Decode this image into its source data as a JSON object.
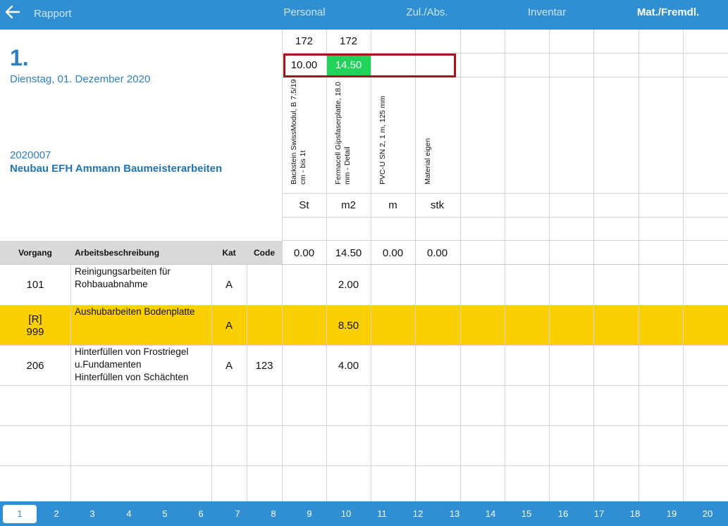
{
  "nav": {
    "back_label": "Rapport",
    "tabs": [
      "Personal",
      "Zul./Abs.",
      "Inventar",
      "Mat./Fremdl."
    ],
    "active_tab": "Mat./Fremdl."
  },
  "report": {
    "day_number": "1.",
    "date": "Dienstag, 01. Dezember 2020",
    "project_number": "2020007",
    "project_name": "Neubau EFH Ammann Baumeisterarbeiten"
  },
  "materials": {
    "ids": [
      "172",
      "172",
      "",
      ""
    ],
    "input_values": [
      "10.00",
      "14.50",
      "",
      ""
    ],
    "names": [
      "Backstein SwissModul, B 7.5/19 cm - bis 1t",
      "Fermacell Gipsfaserplatte, 18.0 mm - Detail",
      "PVC-U SN 2, 1 m, 125 mm",
      "Material eigen"
    ],
    "units": [
      "St",
      "m2",
      "m",
      "stk"
    ],
    "totals": [
      "0.00",
      "14.50",
      "0.00",
      "0.00"
    ]
  },
  "table": {
    "headers": {
      "vorgang": "Vorgang",
      "beschreibung": "Arbeitsbeschreibung",
      "kat": "Kat",
      "code": "Code"
    },
    "rows": [
      {
        "vorgang_tag": "",
        "vorgang": "101",
        "desc": [
          "Reinigungsarbeiten für",
          "Rohbauabnahme"
        ],
        "kat": "A",
        "code": "",
        "m2_value": "2.00"
      },
      {
        "vorgang_tag": "[R]",
        "vorgang": "999",
        "desc": [
          "Aushubarbeiten Bodenplatte"
        ],
        "kat": "A",
        "code": "",
        "m2_value": "8.50"
      },
      {
        "vorgang_tag": "",
        "vorgang": "206",
        "desc": [
          "Hinterfüllen von Frostriegel",
          "u.Fundamenten",
          "Hinterfüllen von Schächten"
        ],
        "kat": "A",
        "code": "123",
        "m2_value": "4.00"
      }
    ]
  },
  "pages": [
    "1",
    "2",
    "3",
    "4",
    "5",
    "6",
    "7",
    "8",
    "9",
    "10",
    "11",
    "12",
    "13",
    "14",
    "15",
    "16",
    "17",
    "18",
    "19",
    "20"
  ],
  "active_page": "1",
  "colors": {
    "nav_blue": "#2f8fd2",
    "text_blue": "#2e7fc2",
    "row_highlight": "#fccf00",
    "input_active": "#22d35a",
    "selection_border": "#a3161f"
  }
}
